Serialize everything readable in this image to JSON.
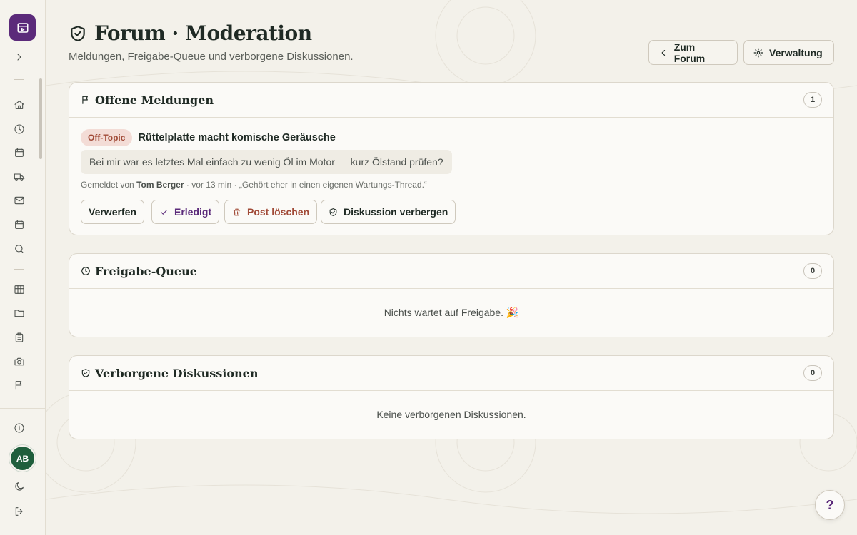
{
  "sidebar": {
    "avatar_initials": "AB",
    "items": [
      {
        "icon": "home-icon"
      },
      {
        "icon": "clock-icon"
      },
      {
        "icon": "calendar-icon"
      },
      {
        "icon": "truck-icon"
      },
      {
        "icon": "mail-icon"
      },
      {
        "icon": "calendar-icon"
      },
      {
        "icon": "search-icon"
      },
      {
        "icon": "table-icon"
      },
      {
        "icon": "folder-icon"
      },
      {
        "icon": "clipboard-icon"
      },
      {
        "icon": "camera-icon"
      },
      {
        "icon": "flag-icon"
      }
    ]
  },
  "header": {
    "title": "Forum · Moderation",
    "subtitle": "Meldungen, Freigabe-Queue und verborgene Diskussionen.",
    "back_label": "Zum Forum",
    "admin_label": "Verwaltung"
  },
  "reports": {
    "title": "Offene Meldungen",
    "count": "1",
    "item": {
      "tag": "Off-Topic",
      "thread_title": "Rüttelplatte macht komische Geräusche",
      "quote": "Bei mir war es letztes Mal einfach zu wenig Öl im Motor — kurz Ölstand prüfen?",
      "meta_prefix": "Gemeldet von",
      "reporter": "Tom Berger",
      "meta_suffix": "· vor 13 min · „Gehört eher in einen eigenen Wartungs-Thread.“"
    },
    "actions": {
      "discard": "Verwerfen",
      "done": "Erledigt",
      "delete": "Post löschen",
      "hide": "Diskussion verbergen"
    }
  },
  "queue": {
    "title": "Freigabe-Queue",
    "count": "0",
    "empty": "Nichts wartet auf Freigabe. 🎉"
  },
  "hidden": {
    "title": "Verborgene Diskussionen",
    "count": "0",
    "empty": "Keine verborgenen Diskussionen."
  },
  "help_label": "?",
  "colors": {
    "brand": "#5b2a7a",
    "avatar": "#1f5e3c",
    "danger": "#a14a37"
  }
}
